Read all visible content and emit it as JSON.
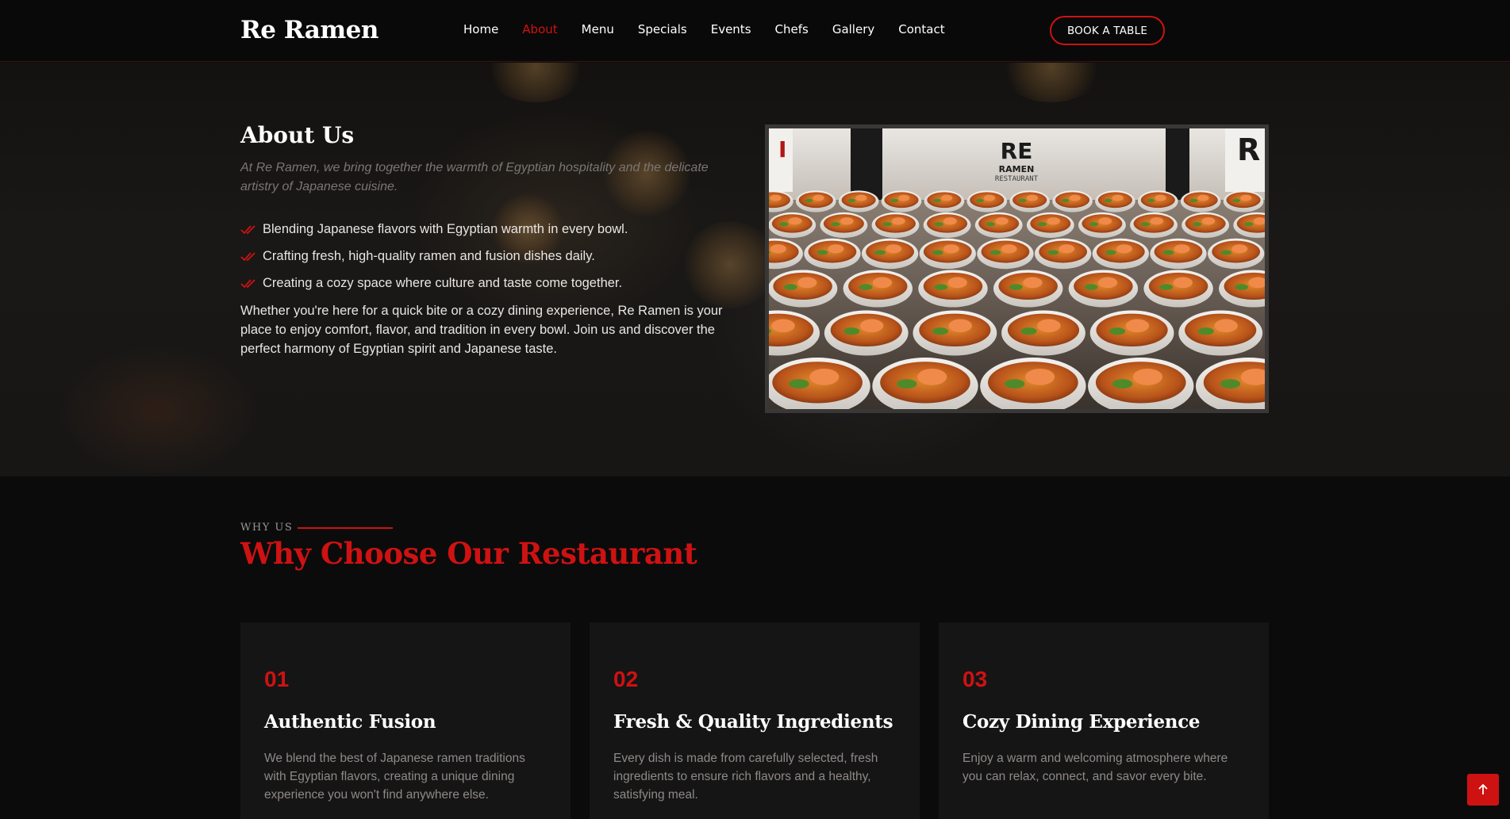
{
  "header": {
    "logo": "Re Ramen",
    "nav": [
      {
        "label": "Home",
        "active": false
      },
      {
        "label": "About",
        "active": true
      },
      {
        "label": "Menu",
        "active": false
      },
      {
        "label": "Specials",
        "active": false
      },
      {
        "label": "Events",
        "active": false
      },
      {
        "label": "Chefs",
        "active": false
      },
      {
        "label": "Gallery",
        "active": false
      },
      {
        "label": "Contact",
        "active": false
      }
    ],
    "cta": "BOOK A TABLE"
  },
  "about": {
    "title": "About Us",
    "intro": "At Re Ramen, we bring together the warmth of Egyptian hospitality and the delicate artistry of Japanese cuisine.",
    "checklist": [
      "Blending Japanese flavors with Egyptian warmth in every bowl.",
      "Crafting fresh, high-quality ramen and fusion dishes daily.",
      "Creating a cozy space where culture and taste come together."
    ],
    "paragraph": "Whether you're here for a quick bite or a cozy dining experience, Re Ramen is your place to enjoy comfort, flavor, and tradition in every bowl. Join us and discover the perfect harmony of Egyptian spirit and Japanese taste.",
    "photo": {
      "sign_line1": "RE",
      "sign_line2": "RAMEN",
      "sign_line3": "RESTAURANT"
    }
  },
  "why_us": {
    "subtitle": "WHY US",
    "title": "Why Choose Our Restaurant",
    "cards": [
      {
        "number": "01",
        "title": "Authentic Fusion",
        "text": "We blend the best of Japanese ramen traditions with Egyptian flavors, creating a unique dining experience you won't find anywhere else."
      },
      {
        "number": "02",
        "title": "Fresh & Quality Ingredients",
        "text": "Every dish is made from carefully selected, fresh ingredients to ensure rich flavors and a healthy, satisfying meal."
      },
      {
        "number": "03",
        "title": "Cozy Dining Experience",
        "text": "Enjoy a warm and welcoming atmosphere where you can relax, connect, and savor every bite."
      }
    ]
  },
  "colors": {
    "accent": "#ce1212",
    "background": "#0c0b0b",
    "card": "#161515"
  },
  "icons": [
    "double-check-icon",
    "arrow-up-icon"
  ]
}
